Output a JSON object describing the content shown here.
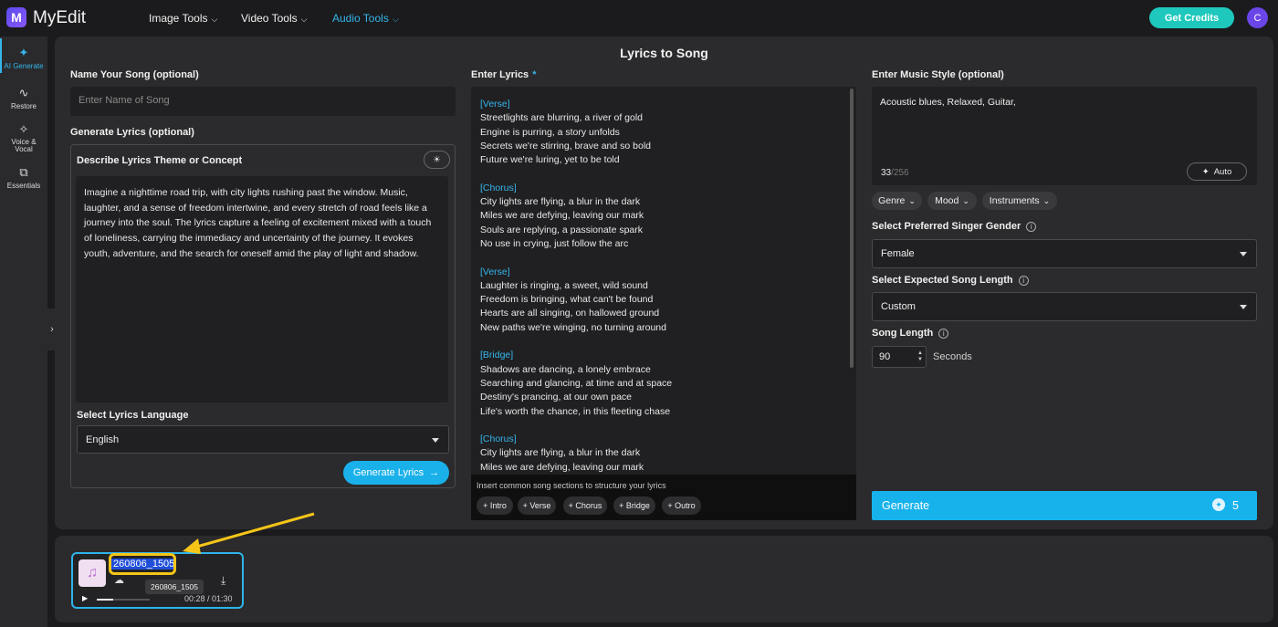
{
  "app": {
    "brand": "MyEdit",
    "logo_letter": "M",
    "nav": [
      {
        "label": "Image Tools"
      },
      {
        "label": "Video Tools"
      },
      {
        "label": "Audio Tools"
      }
    ],
    "get_credits": "Get Credits",
    "user_initial": "C"
  },
  "sidebar": {
    "items": [
      {
        "label": "AI Generate",
        "icon": "magic-wand-icon"
      },
      {
        "label": "Restore",
        "icon": "waveform-icon"
      },
      {
        "label": "Voice & Vocal",
        "icon": "wand-icon"
      },
      {
        "label": "Essentials",
        "icon": "layers-icon"
      }
    ]
  },
  "page": {
    "title": "Lyrics to Song"
  },
  "left": {
    "name_label": "Name Your Song (optional)",
    "name_placeholder": "Enter Name of Song",
    "gen_lyrics_label": "Generate Lyrics (optional)",
    "describe_label": "Describe Lyrics Theme or Concept",
    "description": "Imagine a nighttime road trip, with city lights rushing past the window. Music, laughter, and a sense of freedom intertwine, and every stretch of road feels like a journey into the soul. The lyrics capture a feeling of excitement mixed with a touch of loneliness, carrying the immediacy and uncertainty of the journey. It evokes youth, adventure, and the search for oneself amid the play of light and shadow.",
    "language_label": "Select Lyrics Language",
    "language_value": "English",
    "generate_lyrics_button": "Generate Lyrics"
  },
  "lyrics": {
    "label": "Enter Lyrics",
    "required_mark": "*",
    "sections": [
      {
        "tag": "[Verse]",
        "lines": [
          "Streetlights are blurring, a river of gold",
          "Engine is purring, a story unfolds",
          "Secrets we're stirring, brave and so bold",
          "Future we're luring, yet to be told"
        ]
      },
      {
        "tag": "[Chorus]",
        "lines": [
          "City lights are flying, a blur in the dark",
          "Miles we are defying, leaving our mark",
          "Souls are replying, a passionate spark",
          "No use in crying, just follow the arc"
        ]
      },
      {
        "tag": "[Verse]",
        "lines": [
          "Laughter is ringing, a sweet, wild sound",
          "Freedom is bringing, what can't be found",
          "Hearts are all singing, on hallowed ground",
          "New paths we're winging, no turning around"
        ]
      },
      {
        "tag": "[Bridge]",
        "lines": [
          "Shadows are dancing, a lonely embrace",
          "Searching and glancing, at time and at space",
          "Destiny's prancing, at our own pace",
          "Life's worth the chance, in this fleeting chase"
        ]
      },
      {
        "tag": "[Chorus]",
        "lines": [
          "City lights are flying, a blur in the dark",
          "Miles we are defying, leaving our mark"
        ]
      }
    ],
    "insert_hint": "Insert common song sections to structure your lyrics",
    "chips": [
      "+ Intro",
      "+ Verse",
      "+ Chorus",
      "+ Bridge",
      "+ Outro"
    ]
  },
  "right": {
    "style_label": "Enter Music Style (optional)",
    "style_value": "Acoustic blues, Relaxed, Guitar,",
    "char_count": "33",
    "char_max": "/256",
    "auto_button": "Auto",
    "tags": [
      "Genre",
      "Mood",
      "Instruments"
    ],
    "gender_label": "Select Preferred Singer Gender",
    "gender_value": "Female",
    "length_label": "Select Expected Song Length",
    "length_value": "Custom",
    "song_length_label": "Song Length",
    "song_length_value": "90",
    "seconds_label": "Seconds",
    "generate_button": "Generate",
    "generate_cost": "5"
  },
  "track": {
    "name": "260806_1505",
    "tooltip": "260806_1505",
    "time": "00:28 / 01:30",
    "progress": 0.31
  },
  "colors": {
    "accent": "#17b2ec",
    "credits": "#1ec8bd",
    "highlight": "#f5c518"
  }
}
